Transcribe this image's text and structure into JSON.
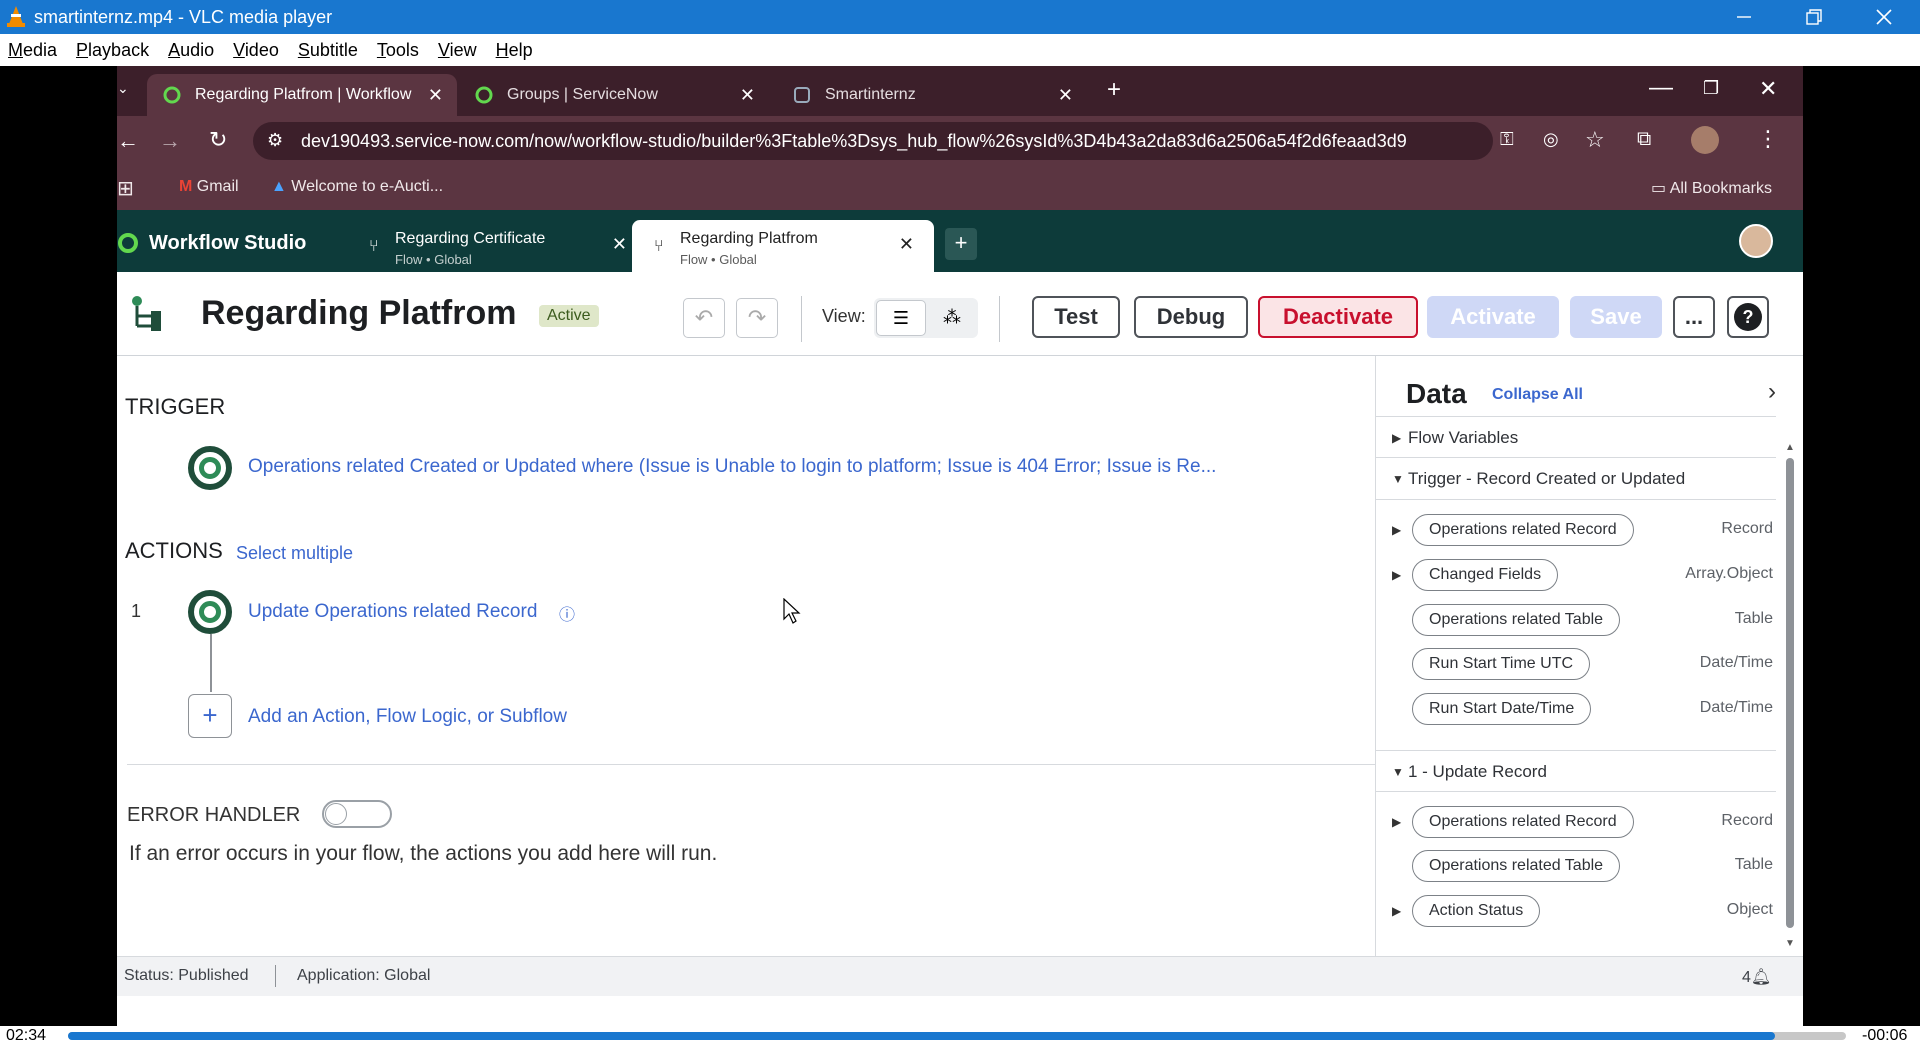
{
  "vlc": {
    "title": "smartinternz.mp4 - VLC media player",
    "menu": [
      "Media",
      "Playback",
      "Audio",
      "Video",
      "Subtitle",
      "Tools",
      "View",
      "Help"
    ],
    "time_elapsed": "02:34",
    "time_remaining": "-00:06",
    "progress": 0.96
  },
  "browser": {
    "tabs": [
      {
        "label": "Regarding Platfrom | Workflow",
        "active": true
      },
      {
        "label": "Groups | ServiceNow",
        "active": false
      },
      {
        "label": "Smartinternz",
        "active": false
      }
    ],
    "url": "dev190493.service-now.com/now/workflow-studio/builder%3Ftable%3Dsys_hub_flow%26sysId%3D4b43a2da83d6a2506a54f2d6feaad3d9",
    "bookmarks": [
      "Gmail",
      "Welcome to e-Aucti..."
    ],
    "all_bookmarks": "All Bookmarks"
  },
  "workflow": {
    "app_name": "Workflow Studio",
    "tabs": [
      {
        "title": "Regarding Certificate",
        "subtitle": "Flow • Global"
      },
      {
        "title": "Regarding Platfrom",
        "subtitle": "Flow • Global"
      }
    ],
    "flow_title": "Regarding Platfrom",
    "status_badge": "Active",
    "view_label": "View:",
    "buttons": {
      "test": "Test",
      "debug": "Debug",
      "deactivate": "Deactivate",
      "activate": "Activate",
      "save": "Save",
      "more": "...",
      "help": "?"
    },
    "trigger_heading": "TRIGGER",
    "trigger_text": "Operations related Created or Updated where (Issue is Unable to login to platform; Issue is 404 Error; Issue is Re...",
    "actions_heading": "ACTIONS",
    "select_multiple": "Select multiple",
    "action_number": "1",
    "action_label": "Update Operations related Record",
    "add_action": "Add an Action, Flow Logic, or Subflow",
    "error_handler_heading": "ERROR HANDLER",
    "error_handler_desc": "If an error occurs in your flow, the actions you add here will run.",
    "status": "Status: Published",
    "application": "Application: Global",
    "notifications": "4"
  },
  "data_panel": {
    "title": "Data",
    "collapse_all": "Collapse All",
    "flow_variables": "Flow Variables",
    "trigger_section": "Trigger - Record Created or Updated",
    "trigger_items": [
      {
        "label": "Operations related Record",
        "type": "Record",
        "expandable": true
      },
      {
        "label": "Changed Fields",
        "type": "Array.Object",
        "expandable": true
      },
      {
        "label": "Operations related Table",
        "type": "Table",
        "expandable": false
      },
      {
        "label": "Run Start Time UTC",
        "type": "Date/Time",
        "expandable": false
      },
      {
        "label": "Run Start Date/Time",
        "type": "Date/Time",
        "expandable": false
      }
    ],
    "update_section": "1 - Update Record",
    "update_items": [
      {
        "label": "Operations related Record",
        "type": "Record",
        "expandable": true
      },
      {
        "label": "Operations related Table",
        "type": "Table",
        "expandable": false
      },
      {
        "label": "Action Status",
        "type": "Object",
        "expandable": true
      }
    ]
  },
  "colors": {
    "vlc_blue": "#1977cf",
    "browser_dark": "#3c1f2a",
    "ws_header": "#0d3b3a",
    "deactivate_red": "#c8102e",
    "link_blue": "#3b67ce"
  }
}
